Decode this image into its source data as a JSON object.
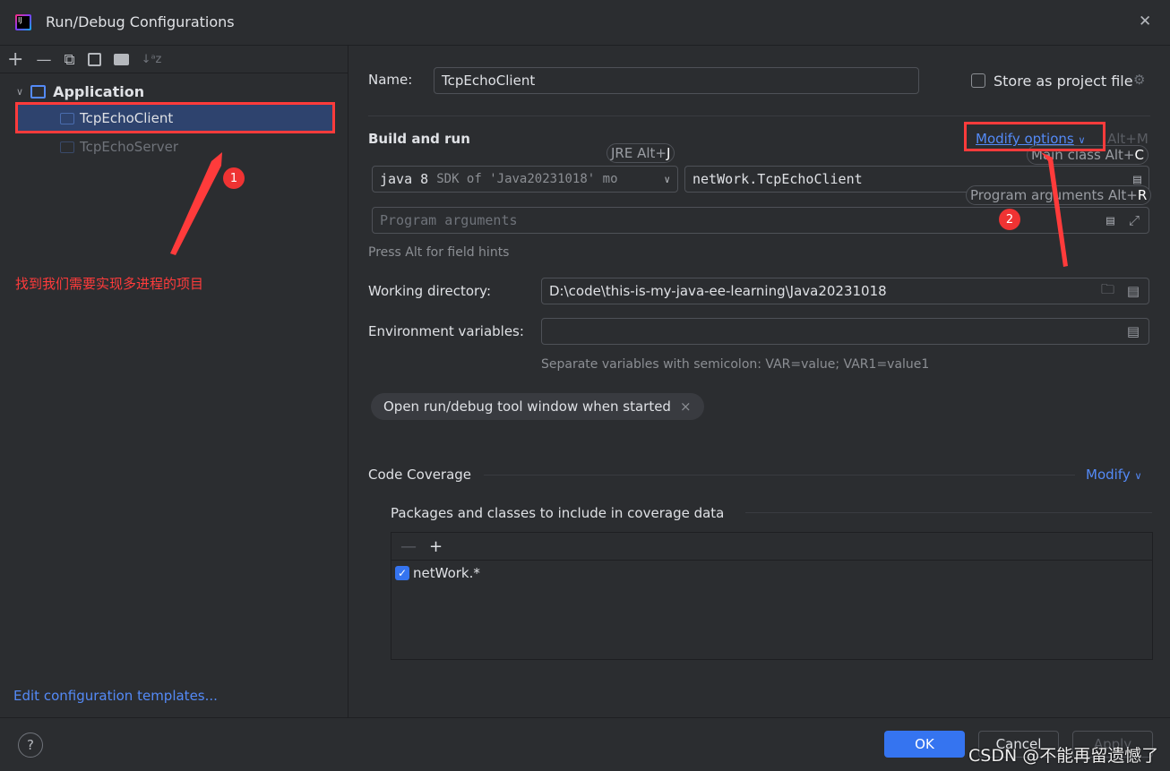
{
  "window": {
    "title": "Run/Debug Configurations",
    "close": "✕"
  },
  "toolbar": {
    "add": "+",
    "remove": "—",
    "copy": "⧉",
    "save": "💾",
    "folder": "📁",
    "sort": "↓ᵃz"
  },
  "tree": {
    "group": "Application",
    "items": [
      {
        "label": "TcpEchoClient",
        "selected": true
      },
      {
        "label": "TcpEchoServer",
        "selected": false
      }
    ]
  },
  "left_footer": {
    "link": "Edit configuration templates..."
  },
  "name": {
    "label": "Name:",
    "value": "TcpEchoClient"
  },
  "store": {
    "label": "Store as project file",
    "checked": false
  },
  "build": {
    "title": "Build and run",
    "modify": "Modify options",
    "modify_shortcut": "Alt+M",
    "jre_hint": "JRE Alt+",
    "jre_key": "J",
    "main_hint": "Main class Alt+",
    "main_key": "C",
    "args_hint": "Program arguments Alt+",
    "args_key": "R",
    "sdk_strong": "java 8",
    "sdk_rest": "SDK of 'Java20231018' mo",
    "main_class": "netWork.TcpEchoClient",
    "args_placeholder": "Program arguments",
    "press_alt": "Press Alt for field hints"
  },
  "workdir": {
    "label": "Working directory:",
    "value": "D:\\code\\this-is-my-java-ee-learning\\Java20231018"
  },
  "env": {
    "label": "Environment variables:",
    "value": "",
    "hint": "Separate variables with semicolon: VAR=value; VAR1=value1"
  },
  "chip": {
    "label": "Open run/debug tool window when started",
    "close": "×"
  },
  "coverage": {
    "title": "Code Coverage",
    "modify": "Modify",
    "packages_title": "Packages and classes to include in coverage data",
    "items": [
      {
        "label": "netWork.*",
        "checked": true
      }
    ]
  },
  "footer": {
    "help": "?",
    "ok": "OK",
    "cancel": "Cancel",
    "apply": "Apply"
  },
  "annotations": {
    "note1": "找到我们需要实现多进程的项目",
    "badge1": "1",
    "badge2": "2",
    "watermark": "CSDN @不能再留遗憾了"
  },
  "colors": {
    "accent": "#3574f0",
    "selection": "#2e436e",
    "annotation": "#ff3b3b",
    "link": "#548af7"
  }
}
